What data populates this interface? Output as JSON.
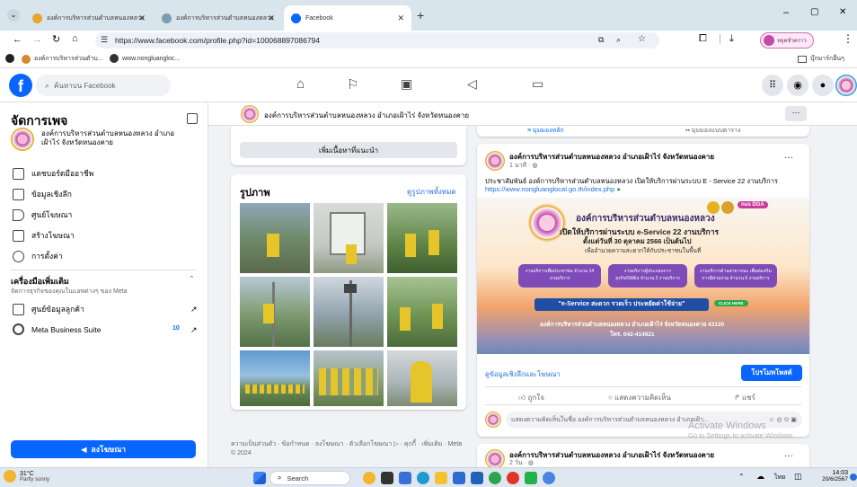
{
  "browser": {
    "tabs": [
      {
        "label": "องค์การบริหารส่วนตำบลหนองหลวง"
      },
      {
        "label": "องค์การบริหารส่วนตำบลหนองหลวง"
      },
      {
        "label": "Facebook"
      }
    ],
    "new_tab": "+",
    "url": "https://www.facebook.com/profile.php?id=100068897086794",
    "bookmarks": [
      {
        "label": "องค์การบริหารส่วนตำบ..."
      },
      {
        "label": "www.nongluangloc..."
      }
    ],
    "bookmarks_other": "บุ๊กมาร์กอื่นๆ",
    "profile_label": "หยุดชั่วคราว"
  },
  "fb": {
    "search_placeholder": "ค้นหาบน Facebook"
  },
  "sidebar": {
    "title": "จัดการเพจ",
    "page_name": "องค์การบริหารส่วนตำบลหนองหลวง อำเภอเฝ้าไร่ จังหวัดหนองคาย",
    "items": [
      {
        "label": "แดชบอร์ดมืออาชีพ"
      },
      {
        "label": "ข้อมูลเชิงลึก"
      },
      {
        "label": "ศูนย์โฆษณา"
      },
      {
        "label": "สร้างโฆษณา"
      },
      {
        "label": "การตั้งค่า"
      }
    ],
    "tools_title": "เครื่องมือเพิ่มเติม",
    "tools_sub": "จัดการธุรกิจของคุณในแอพต่างๆ ของ Meta",
    "tools": [
      {
        "label": "ศูนย์ข้อมูลลูกค้า"
      },
      {
        "label": "Meta Business Suite",
        "badge": "10"
      }
    ],
    "promote": "ลงโฆษณา"
  },
  "page_header": {
    "name": "องค์การบริหารส่วนตำบลหนองหลวง อำเภอเฝ้าไร่ จังหวัดหนองคาย",
    "more": "···"
  },
  "feature_btn": "เพิ่มเนื้อหาที่แนะนำ",
  "photos": {
    "title": "รูปภาพ",
    "see_all": "ดูรูปภาพทั้งหมด"
  },
  "footer_text": "ความเป็นส่วนตัว · ข้อกำหนด · ลงโฆษณา · ตัวเลือกโฆษณา ▷ · คุกกี้ · เพิ่มเติม · Meta © 2024",
  "feed_tabs": [
    "มุมมองหลัก",
    "มุมมองแบบตาราง"
  ],
  "post": {
    "author": "องค์การบริหารส่วนตำบลหนองหลวง อำเภอเฝ้าไร่ จังหวัดหนองคาย",
    "time": "1 นาที · ",
    "text": "ประชาสัมพันธ์ องค์การบริหารส่วนตำบลหนองหลวง เปิดให้บริการผ่านระบบ E - Service 22 งานบริการ",
    "link": "https://www.nongluanglocal.go.th/index.php",
    "banner": {
      "title": "องค์การบริหารส่วนตำบลหนองหลวง",
      "line1": "เปิดให้บริการผ่านระบบ e-Service 22 งานบริการ",
      "line2": "ตั้งแต่วันที่ 30 ตุลาคม 2566 เป็นต้นไป",
      "line3": "เพื่ออำนวยความสะดวกให้กับประชาชนในพื้นที่",
      "box1": "งานบริการเพื่อประชาชน จำนวน 14 งานบริการ",
      "box2": "งานบริการผู้ประกอบการ ธุรกิจ/SMEs จำนวน 2 งานบริการ",
      "box3": "งานบริการด้านสาธารณะ เพื่อส่งเสริมการมีส่วนร่วม จำนวน 6 งานบริการ",
      "slogan": "\"e-Service สะดวก รวดเร็ว ประหยัดค่าใช้จ่าย\"",
      "click": "CLICK HERE",
      "addr": "องค์การบริหารส่วนตำบลหนองหลวง อำเภอเฝ้าไร่ จังหวัดหนองคาย 43120",
      "tel": "โทร. 042-414921",
      "badge": "nus DGA"
    },
    "insights": "ดูข้อมูลเชิงลึกและโฆษณา",
    "boost": "โปรโมทโพสต์",
    "like": "ถูกใจ",
    "comment": "แสดงความคิดเห็น",
    "share": "แชร์",
    "comment_placeholder": "แสดงความคิดเห็นในชื่อ องค์การบริหารส่วนตำบลหนองหลวง อำเภอเฝ้า..."
  },
  "post2": {
    "author": "องค์การบริหารส่วนตำบลหนองหลวง อำเภอเฝ้าไร่ จังหวัดหนองคาย",
    "time": "2 วัน · "
  },
  "watermark": {
    "line1": "Activate Windows",
    "line2": "Go to Settings to activate Windows."
  },
  "taskbar": {
    "weather_temp": "31°C",
    "weather_desc": "Partly sunny",
    "search": "Search",
    "time": "14:03",
    "date": "20/6/2567"
  },
  "colors": {
    "fb_blue": "#0866ff",
    "accent_yellow": "#f2c500"
  }
}
